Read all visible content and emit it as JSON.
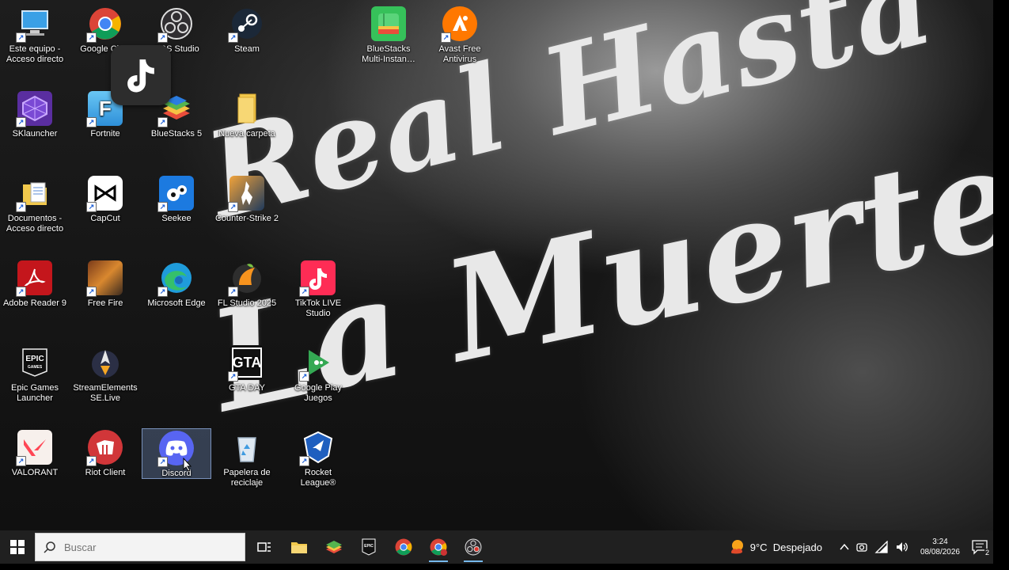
{
  "wallpaper": {
    "line1": "Real Hasta",
    "line2": "La Muerte"
  },
  "desktop_icons": [
    {
      "label": "Este equipo - Acceso directo",
      "icon": "computer-icon"
    },
    {
      "label": "Google Ch…",
      "icon": "chrome-icon"
    },
    {
      "label": "OBS Studio",
      "icon": "obs-icon"
    },
    {
      "label": "Steam",
      "icon": "steam-icon"
    },
    {
      "label": "BlueStacks Multi-Instan…",
      "icon": "bluestacks-multi-icon"
    },
    {
      "label": "Avast Free Antivirus",
      "icon": "avast-icon"
    },
    {
      "label": "SKlauncher",
      "icon": "sklauncher-icon"
    },
    {
      "label": "Fortnite",
      "icon": "fortnite-icon"
    },
    {
      "label": "BlueStacks 5",
      "icon": "bluestacks-icon"
    },
    {
      "label": "Nueva carpeta",
      "icon": "folder-icon"
    },
    {
      "label": "Documentos - Acceso directo",
      "icon": "documents-icon"
    },
    {
      "label": "CapCut",
      "icon": "capcut-icon"
    },
    {
      "label": "Seekee",
      "icon": "seekee-icon"
    },
    {
      "label": "Counter-Strike 2",
      "icon": "counter-strike-icon"
    },
    {
      "label": "Adobe Reader 9",
      "icon": "adobe-reader-icon"
    },
    {
      "label": "Free Fire",
      "icon": "free-fire-icon"
    },
    {
      "label": "Microsoft Edge",
      "icon": "edge-icon"
    },
    {
      "label": "FL Studio 2025",
      "icon": "fl-studio-icon"
    },
    {
      "label": "TikTok LIVE Studio",
      "icon": "tiktok-live-icon"
    },
    {
      "label": "Epic Games Launcher",
      "icon": "epic-games-icon"
    },
    {
      "label": "StreamElements SE.Live",
      "icon": "streamelements-icon"
    },
    {
      "label": "GTA DAY",
      "icon": "gta-icon"
    },
    {
      "label": "Google Play Juegos",
      "icon": "google-play-games-icon"
    },
    {
      "label": "VALORANT",
      "icon": "valorant-icon"
    },
    {
      "label": "Riot Client",
      "icon": "riot-client-icon"
    },
    {
      "label": "Discord",
      "icon": "discord-icon"
    },
    {
      "label": "Papelera de reciclaje",
      "icon": "recycle-bin-icon"
    },
    {
      "label": "Rocket League®",
      "icon": "rocket-league-icon"
    }
  ],
  "floating_overlay": {
    "icon": "tiktok-icon"
  },
  "taskbar": {
    "search_placeholder": "Buscar",
    "pinned": [
      "task-view-icon",
      "file-explorer-icon",
      "bluestacks-icon",
      "epic-games-icon",
      "chrome-icon",
      "chrome-profile-icon",
      "obs-icon"
    ],
    "weather": {
      "temp": "9°C",
      "condition": "Despejado"
    },
    "clock": {
      "time": "3:24",
      "date": "08/08/2026"
    },
    "notifications_count": "2"
  },
  "colors": {
    "taskbar": "#202020",
    "discord": "#5865f2",
    "chrome_active_underline": "#76b9ed"
  }
}
